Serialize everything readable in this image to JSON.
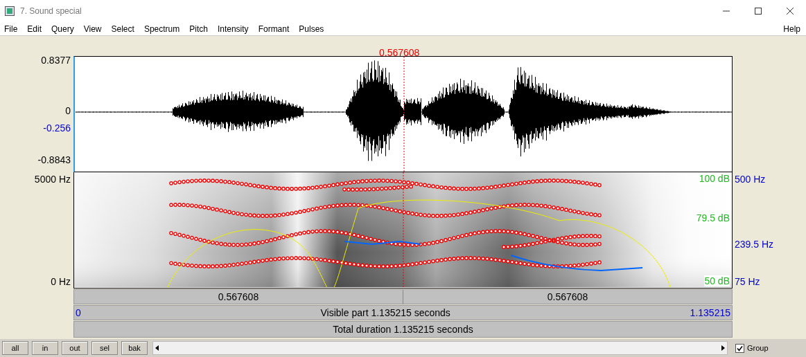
{
  "window": {
    "title": "7. Sound special"
  },
  "menu": [
    "File",
    "Edit",
    "Query",
    "View",
    "Select",
    "Spectrum",
    "Pitch",
    "Intensity",
    "Formant",
    "Pulses"
  ],
  "help": "Help",
  "cursor": {
    "time": "0.567608"
  },
  "waveform": {
    "y_labels": [
      {
        "text": "0.8377",
        "kind": "max"
      },
      {
        "text": "0",
        "kind": "zero"
      },
      {
        "text": "-0.256",
        "kind": "cursor"
      },
      {
        "text": "-0.8843",
        "kind": "min"
      }
    ]
  },
  "spectrogram": {
    "left_labels": [
      {
        "text": "5000 Hz",
        "kind": "top"
      },
      {
        "text": "0 Hz",
        "kind": "bottom"
      }
    ],
    "intensity_labels": [
      {
        "text": "100 dB",
        "kind": "top"
      },
      {
        "text": "79.5 dB",
        "kind": "cursor"
      },
      {
        "text": "50 dB",
        "kind": "bottom"
      }
    ],
    "pitch_labels": [
      {
        "text": "500 Hz",
        "kind": "top"
      },
      {
        "text": "239.5 Hz",
        "kind": "cursor"
      },
      {
        "text": "75 Hz",
        "kind": "bottom"
      }
    ]
  },
  "time_bars": {
    "segments": [
      "0.567608",
      "0.567608"
    ],
    "visible": {
      "start": "0",
      "text": "Visible part 1.135215 seconds",
      "end": "1.135215"
    },
    "total": "Total duration 1.135215 seconds"
  },
  "buttons": [
    "all",
    "in",
    "out",
    "sel",
    "bak"
  ],
  "group": {
    "label": "Group",
    "checked": true
  }
}
